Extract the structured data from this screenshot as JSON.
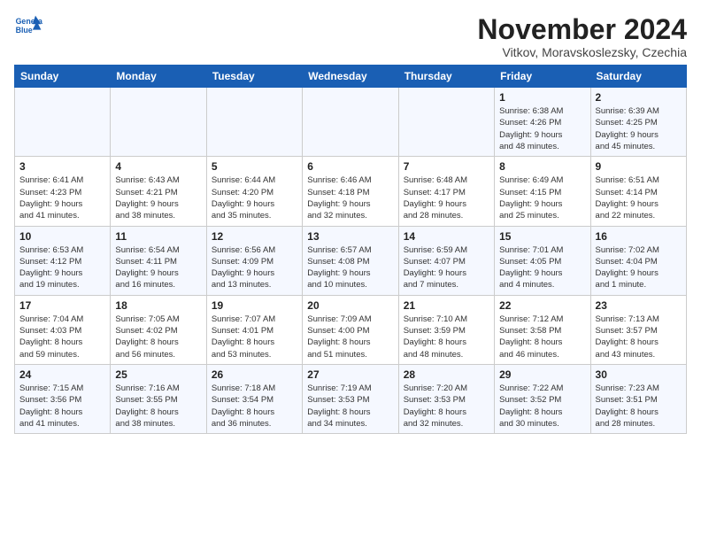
{
  "logo": {
    "line1": "General",
    "line2": "Blue"
  },
  "title": "November 2024",
  "subtitle": "Vitkov, Moravskoslezsky, Czechia",
  "weekdays": [
    "Sunday",
    "Monday",
    "Tuesday",
    "Wednesday",
    "Thursday",
    "Friday",
    "Saturday"
  ],
  "weeks": [
    [
      {
        "day": "",
        "info": ""
      },
      {
        "day": "",
        "info": ""
      },
      {
        "day": "",
        "info": ""
      },
      {
        "day": "",
        "info": ""
      },
      {
        "day": "",
        "info": ""
      },
      {
        "day": "1",
        "info": "Sunrise: 6:38 AM\nSunset: 4:26 PM\nDaylight: 9 hours\nand 48 minutes."
      },
      {
        "day": "2",
        "info": "Sunrise: 6:39 AM\nSunset: 4:25 PM\nDaylight: 9 hours\nand 45 minutes."
      }
    ],
    [
      {
        "day": "3",
        "info": "Sunrise: 6:41 AM\nSunset: 4:23 PM\nDaylight: 9 hours\nand 41 minutes."
      },
      {
        "day": "4",
        "info": "Sunrise: 6:43 AM\nSunset: 4:21 PM\nDaylight: 9 hours\nand 38 minutes."
      },
      {
        "day": "5",
        "info": "Sunrise: 6:44 AM\nSunset: 4:20 PM\nDaylight: 9 hours\nand 35 minutes."
      },
      {
        "day": "6",
        "info": "Sunrise: 6:46 AM\nSunset: 4:18 PM\nDaylight: 9 hours\nand 32 minutes."
      },
      {
        "day": "7",
        "info": "Sunrise: 6:48 AM\nSunset: 4:17 PM\nDaylight: 9 hours\nand 28 minutes."
      },
      {
        "day": "8",
        "info": "Sunrise: 6:49 AM\nSunset: 4:15 PM\nDaylight: 9 hours\nand 25 minutes."
      },
      {
        "day": "9",
        "info": "Sunrise: 6:51 AM\nSunset: 4:14 PM\nDaylight: 9 hours\nand 22 minutes."
      }
    ],
    [
      {
        "day": "10",
        "info": "Sunrise: 6:53 AM\nSunset: 4:12 PM\nDaylight: 9 hours\nand 19 minutes."
      },
      {
        "day": "11",
        "info": "Sunrise: 6:54 AM\nSunset: 4:11 PM\nDaylight: 9 hours\nand 16 minutes."
      },
      {
        "day": "12",
        "info": "Sunrise: 6:56 AM\nSunset: 4:09 PM\nDaylight: 9 hours\nand 13 minutes."
      },
      {
        "day": "13",
        "info": "Sunrise: 6:57 AM\nSunset: 4:08 PM\nDaylight: 9 hours\nand 10 minutes."
      },
      {
        "day": "14",
        "info": "Sunrise: 6:59 AM\nSunset: 4:07 PM\nDaylight: 9 hours\nand 7 minutes."
      },
      {
        "day": "15",
        "info": "Sunrise: 7:01 AM\nSunset: 4:05 PM\nDaylight: 9 hours\nand 4 minutes."
      },
      {
        "day": "16",
        "info": "Sunrise: 7:02 AM\nSunset: 4:04 PM\nDaylight: 9 hours\nand 1 minute."
      }
    ],
    [
      {
        "day": "17",
        "info": "Sunrise: 7:04 AM\nSunset: 4:03 PM\nDaylight: 8 hours\nand 59 minutes."
      },
      {
        "day": "18",
        "info": "Sunrise: 7:05 AM\nSunset: 4:02 PM\nDaylight: 8 hours\nand 56 minutes."
      },
      {
        "day": "19",
        "info": "Sunrise: 7:07 AM\nSunset: 4:01 PM\nDaylight: 8 hours\nand 53 minutes."
      },
      {
        "day": "20",
        "info": "Sunrise: 7:09 AM\nSunset: 4:00 PM\nDaylight: 8 hours\nand 51 minutes."
      },
      {
        "day": "21",
        "info": "Sunrise: 7:10 AM\nSunset: 3:59 PM\nDaylight: 8 hours\nand 48 minutes."
      },
      {
        "day": "22",
        "info": "Sunrise: 7:12 AM\nSunset: 3:58 PM\nDaylight: 8 hours\nand 46 minutes."
      },
      {
        "day": "23",
        "info": "Sunrise: 7:13 AM\nSunset: 3:57 PM\nDaylight: 8 hours\nand 43 minutes."
      }
    ],
    [
      {
        "day": "24",
        "info": "Sunrise: 7:15 AM\nSunset: 3:56 PM\nDaylight: 8 hours\nand 41 minutes."
      },
      {
        "day": "25",
        "info": "Sunrise: 7:16 AM\nSunset: 3:55 PM\nDaylight: 8 hours\nand 38 minutes."
      },
      {
        "day": "26",
        "info": "Sunrise: 7:18 AM\nSunset: 3:54 PM\nDaylight: 8 hours\nand 36 minutes."
      },
      {
        "day": "27",
        "info": "Sunrise: 7:19 AM\nSunset: 3:53 PM\nDaylight: 8 hours\nand 34 minutes."
      },
      {
        "day": "28",
        "info": "Sunrise: 7:20 AM\nSunset: 3:53 PM\nDaylight: 8 hours\nand 32 minutes."
      },
      {
        "day": "29",
        "info": "Sunrise: 7:22 AM\nSunset: 3:52 PM\nDaylight: 8 hours\nand 30 minutes."
      },
      {
        "day": "30",
        "info": "Sunrise: 7:23 AM\nSunset: 3:51 PM\nDaylight: 8 hours\nand 28 minutes."
      }
    ]
  ]
}
